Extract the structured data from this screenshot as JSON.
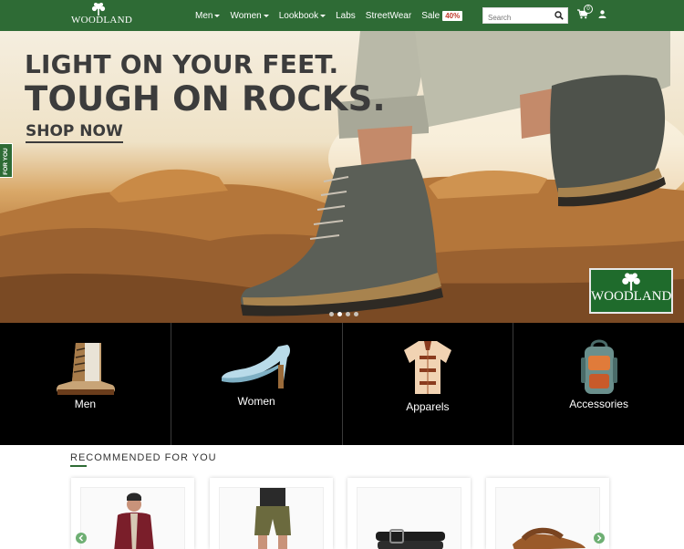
{
  "brand": {
    "name": "WOODLAND",
    "color": "#2e6b35"
  },
  "nav": {
    "items": [
      {
        "label": "Men",
        "has_dropdown": true
      },
      {
        "label": "Women",
        "has_dropdown": true
      },
      {
        "label": "Lookbook",
        "has_dropdown": true
      },
      {
        "label": "Labs",
        "has_dropdown": false
      },
      {
        "label": "StreetWear",
        "has_dropdown": false
      },
      {
        "label": "Sale",
        "has_dropdown": false
      }
    ],
    "sale_badge": "40%",
    "search_placeholder": "Search",
    "cart_count": "0",
    "icons": [
      "search-icon",
      "cart-icon",
      "user-icon"
    ]
  },
  "hero": {
    "headline_1": "LIGHT ON YOUR FEET.",
    "headline_2": "TOUGH ON ROCKS.",
    "cta": "SHOP NOW",
    "badge_logo": "WOODLAND",
    "slides": 4,
    "active_slide": 2
  },
  "side_tab": {
    "label": "FOR YOU"
  },
  "categories": [
    {
      "label": "Men",
      "icon": "boot-icon"
    },
    {
      "label": "Women",
      "icon": "heel-icon"
    },
    {
      "label": "Apparels",
      "icon": "shirt-icon"
    },
    {
      "label": "Accessories",
      "icon": "backpack-icon"
    }
  ],
  "recommended": {
    "title": "RECOMMENDED FOR YOU",
    "products": [
      {
        "icon": "jacket-model-icon"
      },
      {
        "icon": "shorts-model-icon"
      },
      {
        "icon": "belt-icon"
      },
      {
        "icon": "sandal-icon"
      }
    ]
  }
}
